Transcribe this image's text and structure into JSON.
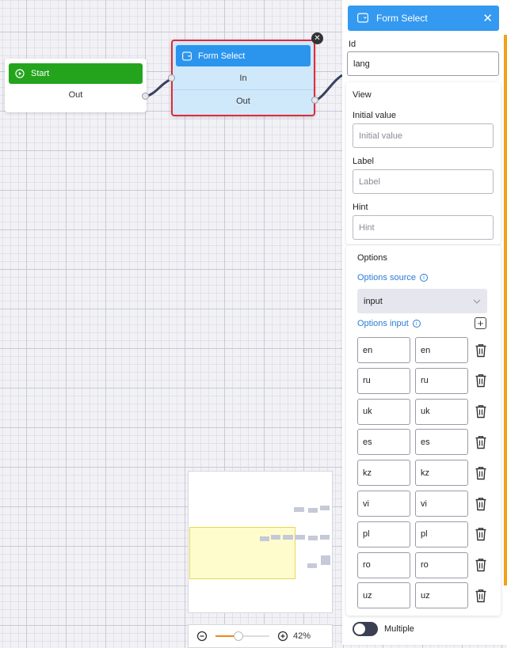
{
  "canvas": {
    "start_node": {
      "title": "Start",
      "out_label": "Out",
      "head_color": "#24a41d"
    },
    "form_node": {
      "title": "Form Select",
      "in_label": "In",
      "out_label": "Out",
      "head_color": "#2b95ee",
      "border_color": "#e02a3a"
    },
    "zoom": {
      "level_label": "42%",
      "level_fraction": 0.42
    }
  },
  "panel": {
    "header_title": "Form Select",
    "id": {
      "label": "Id",
      "value": "lang"
    },
    "view": {
      "title": "View",
      "initial_value": {
        "label": "Initial value",
        "placeholder": "Initial value"
      },
      "label_field": {
        "label": "Label",
        "placeholder": "Label"
      },
      "hint_field": {
        "label": "Hint",
        "placeholder": "Hint"
      }
    },
    "options": {
      "title": "Options",
      "source_label": "Options source",
      "source_value": "input",
      "input_label": "Options input",
      "rows": [
        {
          "key": "en",
          "value": "en"
        },
        {
          "key": "ru",
          "value": "ru"
        },
        {
          "key": "uk",
          "value": "uk"
        },
        {
          "key": "es",
          "value": "es"
        },
        {
          "key": "kz",
          "value": "kz"
        },
        {
          "key": "vi",
          "value": "vi"
        },
        {
          "key": "pl",
          "value": "pl"
        },
        {
          "key": "ro",
          "value": "ro"
        },
        {
          "key": "uz",
          "value": "uz"
        }
      ]
    },
    "multiple": {
      "label": "Multiple",
      "enabled": false
    }
  },
  "colors": {
    "accent": "#3499f0",
    "scroll_accent": "#f0a21c",
    "zoom_fill": "#e78a16"
  }
}
